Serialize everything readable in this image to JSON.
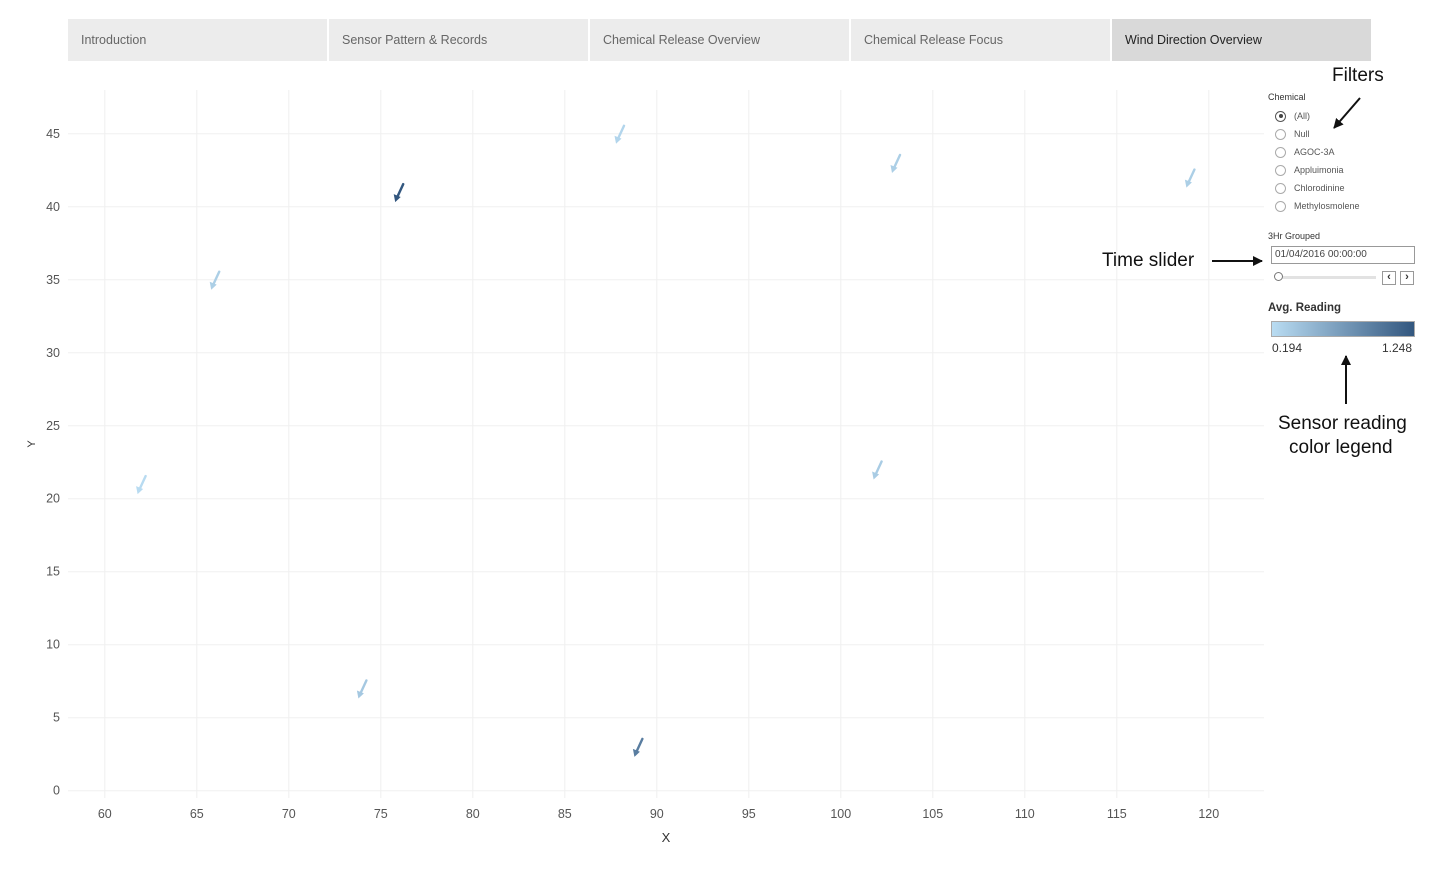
{
  "tabs": [
    {
      "label": "Introduction",
      "active": false
    },
    {
      "label": "Sensor Pattern & Records",
      "active": false
    },
    {
      "label": "Chemical Release Overview",
      "active": false
    },
    {
      "label": "Chemical Release Focus",
      "active": false
    },
    {
      "label": "Wind Direction Overview",
      "active": true
    }
  ],
  "filter": {
    "title": "Chemical",
    "options": [
      "(All)",
      "Null",
      "AGOC-3A",
      "Appluimonia",
      "Chlorodinine",
      "Methylosmolene"
    ],
    "selected": "(All)"
  },
  "time_slider": {
    "title": "3Hr Grouped",
    "value": "01/04/2016 00:00:00",
    "prev_icon": "chevron-left-icon",
    "next_icon": "chevron-right-icon"
  },
  "legend": {
    "title": "Avg. Reading",
    "min_label": "0.194",
    "max_label": "1.248",
    "min_value": 0.194,
    "max_value": 1.248,
    "color_low": "#b9dcf2",
    "color_high": "#33577f"
  },
  "annotations": {
    "filters": "Filters",
    "time_slider": "Time slider",
    "legend_line1": "Sensor reading",
    "legend_line2": "color legend"
  },
  "chart_data": {
    "type": "scatter",
    "marker": "wind-direction-arrow",
    "xlabel": "X",
    "ylabel": "Y",
    "xlim": [
      58,
      123
    ],
    "ylim": [
      -0.5,
      48
    ],
    "xticks": [
      60,
      65,
      70,
      75,
      80,
      85,
      90,
      95,
      100,
      105,
      110,
      115,
      120
    ],
    "yticks": [
      0,
      5,
      10,
      15,
      20,
      25,
      30,
      35,
      40,
      45
    ],
    "grid": true,
    "points": [
      {
        "x": 88,
        "y": 45,
        "reading": 0.25
      },
      {
        "x": 76,
        "y": 41,
        "reading": 1.248
      },
      {
        "x": 103,
        "y": 43,
        "reading": 0.3
      },
      {
        "x": 119,
        "y": 42,
        "reading": 0.3
      },
      {
        "x": 66,
        "y": 35,
        "reading": 0.3
      },
      {
        "x": 62,
        "y": 21,
        "reading": 0.2
      },
      {
        "x": 102,
        "y": 22,
        "reading": 0.32
      },
      {
        "x": 74,
        "y": 7,
        "reading": 0.35
      },
      {
        "x": 89,
        "y": 3,
        "reading": 0.95
      }
    ]
  }
}
